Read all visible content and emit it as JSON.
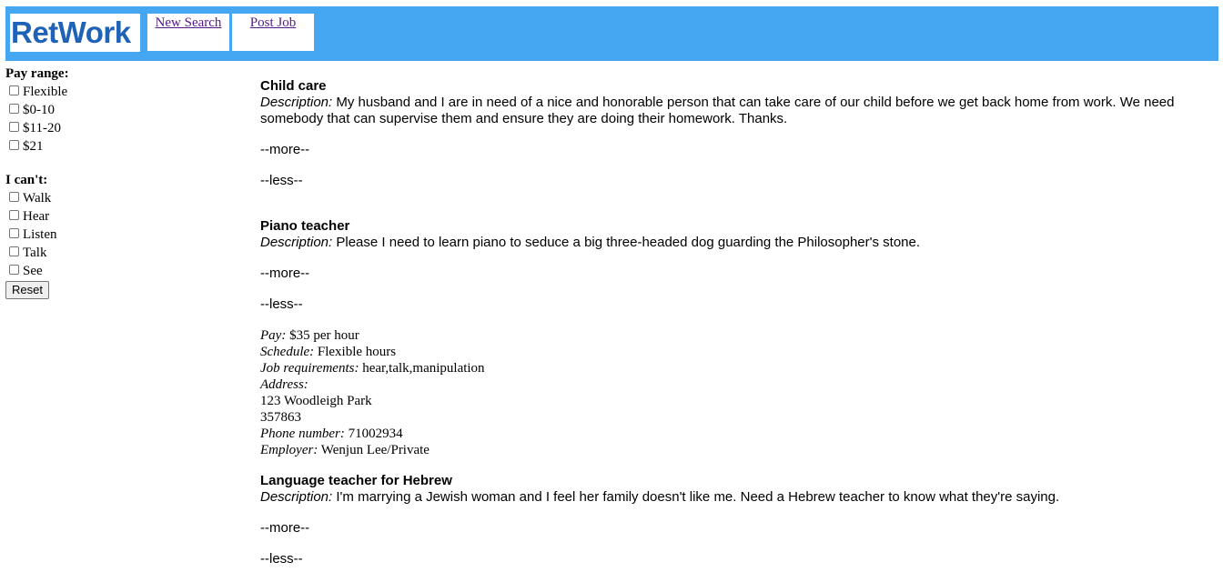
{
  "header": {
    "logo": "RetWork",
    "nav": [
      {
        "label": "New Search"
      },
      {
        "label": "Post Job"
      }
    ]
  },
  "sidebar": {
    "pay_range": {
      "title": "Pay range:",
      "options": [
        "Flexible",
        "$0-10",
        "$11-20",
        "$21"
      ]
    },
    "cant": {
      "title": "I can't:",
      "options": [
        "Walk",
        "Hear",
        "Listen",
        "Talk",
        "See"
      ]
    },
    "reset_label": "Reset"
  },
  "jobs": [
    {
      "title": "Child care",
      "desc_label": "Description:",
      "desc": "My husband and I are in need of a nice and honorable person that can take care of our child before we get back home from work. We need somebody that can supervise them and ensure they are doing their homework. Thanks.",
      "more": "--more--",
      "less": "--less--"
    },
    {
      "title": "Piano teacher",
      "desc_label": "Description:",
      "desc": "Please I need to learn piano to seduce a big three-headed dog guarding the Philosopher's stone.",
      "more": "--more--",
      "less": "--less--",
      "details": {
        "pay_label": "Pay:",
        "pay": "$35 per hour",
        "schedule_label": "Schedule:",
        "schedule": "Flexible hours",
        "req_label": "Job requirements:",
        "req": "hear,talk,manipulation",
        "address_label": "Address:",
        "address_line1": "123 Woodleigh Park",
        "address_line2": "357863",
        "phone_label": "Phone number:",
        "phone": "71002934",
        "employer_label": "Employer:",
        "employer": "Wenjun Lee/Private"
      }
    },
    {
      "title": "Language teacher for Hebrew",
      "desc_label": "Description:",
      "desc": "I'm marrying a Jewish woman and I feel her family doesn't like me. Need a Hebrew teacher to know what they're saying.",
      "more": "--more--",
      "less": "--less--"
    }
  ]
}
